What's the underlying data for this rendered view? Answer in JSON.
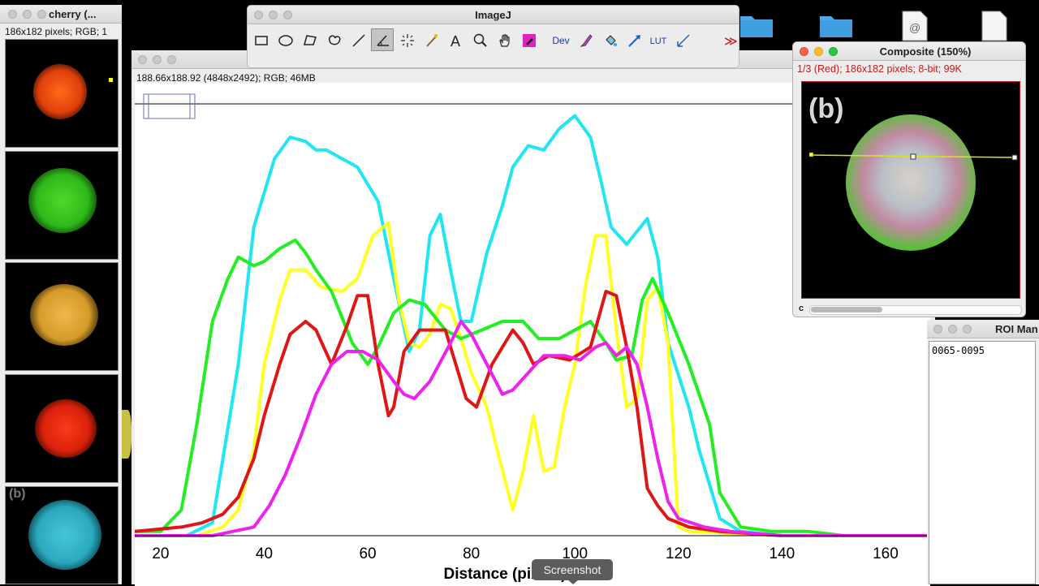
{
  "stack_window": {
    "title": "cherry (...",
    "info": "186x182 pixels; RGB; 1",
    "thumb_b_label": "(b)"
  },
  "plot_window": {
    "info": "188.66x188.92   (4848x2492); RGB; 46MB"
  },
  "imagej": {
    "title": "ImageJ",
    "tools": [
      {
        "name": "rectangle-tool"
      },
      {
        "name": "oval-tool"
      },
      {
        "name": "polygon-tool"
      },
      {
        "name": "freehand-tool"
      },
      {
        "name": "line-tool"
      },
      {
        "name": "angle-tool"
      },
      {
        "name": "point-tool"
      },
      {
        "name": "wand-tool"
      },
      {
        "name": "text-tool"
      },
      {
        "name": "magnifier-tool"
      },
      {
        "name": "hand-tool"
      },
      {
        "name": "color-picker-tool"
      },
      {
        "name": "dev-tool",
        "label": "Dev"
      },
      {
        "name": "brush-tool"
      },
      {
        "name": "flood-fill-tool"
      },
      {
        "name": "arrow-tool"
      },
      {
        "name": "lut-tool",
        "label": "LUT"
      },
      {
        "name": "stack-tool"
      },
      {
        "name": "more-tools"
      }
    ]
  },
  "composite": {
    "title": "Composite (150%)",
    "info": "1/3 (Red); 186x182 pixels; 8-bit; 99K",
    "panel_label": "(b)",
    "channel_label": "c"
  },
  "roi_manager": {
    "title": "ROI Man",
    "items": [
      "0065-0095"
    ]
  },
  "tooltip": "Screenshot",
  "chart_data": {
    "type": "line",
    "xlabel": "Distance (pixels)",
    "ylabel": "",
    "xlim": [
      15,
      168
    ],
    "ylim": [
      0,
      100
    ],
    "x_ticks": [
      20,
      40,
      60,
      80,
      100,
      120,
      140,
      160
    ],
    "grid": false,
    "colors": {
      "cyan": "#1fe6f2",
      "yellow": "#ffff22",
      "green": "#22ee22",
      "red": "#e01515",
      "magenta": "#ee22ee"
    },
    "series": [
      {
        "color": "cyan",
        "points": [
          [
            15,
            0
          ],
          [
            25,
            0
          ],
          [
            30,
            3
          ],
          [
            35,
            40
          ],
          [
            38,
            72
          ],
          [
            42,
            88
          ],
          [
            45,
            93
          ],
          [
            48,
            92
          ],
          [
            50,
            90
          ],
          [
            52,
            90
          ],
          [
            55,
            88
          ],
          [
            58,
            86
          ],
          [
            62,
            78
          ],
          [
            65,
            60
          ],
          [
            68,
            43
          ],
          [
            70,
            48
          ],
          [
            72,
            70
          ],
          [
            74,
            75
          ],
          [
            76,
            62
          ],
          [
            78,
            50
          ],
          [
            80,
            50
          ],
          [
            83,
            66
          ],
          [
            86,
            77
          ],
          [
            88,
            86
          ],
          [
            91,
            91
          ],
          [
            94,
            90
          ],
          [
            97,
            95
          ],
          [
            100,
            98
          ],
          [
            103,
            93
          ],
          [
            105,
            83
          ],
          [
            107,
            72
          ],
          [
            110,
            68
          ],
          [
            114,
            74
          ],
          [
            116,
            65
          ],
          [
            118,
            45
          ],
          [
            122,
            30
          ],
          [
            124,
            20
          ],
          [
            128,
            4
          ],
          [
            132,
            1
          ],
          [
            140,
            0
          ],
          [
            168,
            0
          ]
        ]
      },
      {
        "color": "yellow",
        "points": [
          [
            15,
            0
          ],
          [
            27,
            0
          ],
          [
            32,
            2
          ],
          [
            35,
            6
          ],
          [
            38,
            20
          ],
          [
            40,
            40
          ],
          [
            43,
            55
          ],
          [
            45,
            62
          ],
          [
            48,
            62
          ],
          [
            51,
            58
          ],
          [
            55,
            57
          ],
          [
            58,
            60
          ],
          [
            61,
            70
          ],
          [
            64,
            73
          ],
          [
            66,
            55
          ],
          [
            68,
            45
          ],
          [
            70,
            44
          ],
          [
            72,
            47
          ],
          [
            74,
            54
          ],
          [
            76,
            53
          ],
          [
            78,
            46
          ],
          [
            80,
            38
          ],
          [
            83,
            30
          ],
          [
            85,
            20
          ],
          [
            88,
            6
          ],
          [
            90,
            15
          ],
          [
            92,
            28
          ],
          [
            94,
            15
          ],
          [
            96,
            16
          ],
          [
            98,
            30
          ],
          [
            100,
            40
          ],
          [
            102,
            58
          ],
          [
            104,
            70
          ],
          [
            106,
            70
          ],
          [
            108,
            48
          ],
          [
            110,
            30
          ],
          [
            112,
            32
          ],
          [
            114,
            55
          ],
          [
            116,
            58
          ],
          [
            118,
            45
          ],
          [
            120,
            2
          ],
          [
            122,
            1
          ],
          [
            140,
            0
          ],
          [
            168,
            0
          ]
        ]
      },
      {
        "color": "green",
        "points": [
          [
            15,
            1
          ],
          [
            20,
            1
          ],
          [
            24,
            6
          ],
          [
            27,
            26
          ],
          [
            30,
            50
          ],
          [
            33,
            60
          ],
          [
            35,
            65
          ],
          [
            38,
            63
          ],
          [
            40,
            64
          ],
          [
            43,
            67
          ],
          [
            46,
            69
          ],
          [
            48,
            66
          ],
          [
            50,
            62
          ],
          [
            53,
            57
          ],
          [
            57,
            45
          ],
          [
            60,
            40
          ],
          [
            62,
            44
          ],
          [
            65,
            52
          ],
          [
            68,
            55
          ],
          [
            71,
            54
          ],
          [
            75,
            48
          ],
          [
            78,
            46
          ],
          [
            82,
            48
          ],
          [
            86,
            50
          ],
          [
            90,
            50
          ],
          [
            93,
            46
          ],
          [
            97,
            46
          ],
          [
            100,
            48
          ],
          [
            103,
            50
          ],
          [
            106,
            45
          ],
          [
            108,
            41
          ],
          [
            111,
            42
          ],
          [
            113,
            55
          ],
          [
            115,
            60
          ],
          [
            118,
            52
          ],
          [
            122,
            40
          ],
          [
            126,
            26
          ],
          [
            128,
            10
          ],
          [
            132,
            2
          ],
          [
            138,
            1
          ],
          [
            145,
            1
          ],
          [
            152,
            0
          ],
          [
            168,
            0
          ]
        ]
      },
      {
        "color": "red",
        "points": [
          [
            15,
            1
          ],
          [
            24,
            2
          ],
          [
            28,
            3
          ],
          [
            32,
            5
          ],
          [
            35,
            9
          ],
          [
            38,
            18
          ],
          [
            40,
            28
          ],
          [
            43,
            40
          ],
          [
            45,
            47
          ],
          [
            48,
            50
          ],
          [
            50,
            48
          ],
          [
            53,
            40
          ],
          [
            56,
            49
          ],
          [
            58,
            56
          ],
          [
            60,
            56
          ],
          [
            62,
            40
          ],
          [
            64,
            28
          ],
          [
            65,
            30
          ],
          [
            67,
            43
          ],
          [
            70,
            48
          ],
          [
            73,
            48
          ],
          [
            75,
            48
          ],
          [
            77,
            40
          ],
          [
            79,
            32
          ],
          [
            81,
            30
          ],
          [
            84,
            40
          ],
          [
            88,
            48
          ],
          [
            90,
            45
          ],
          [
            92,
            40
          ],
          [
            95,
            42
          ],
          [
            99,
            41
          ],
          [
            103,
            44
          ],
          [
            106,
            57
          ],
          [
            108,
            56
          ],
          [
            110,
            44
          ],
          [
            112,
            30
          ],
          [
            114,
            11
          ],
          [
            116,
            7
          ],
          [
            118,
            4
          ],
          [
            122,
            2
          ],
          [
            128,
            1
          ],
          [
            140,
            0
          ],
          [
            168,
            0
          ]
        ]
      },
      {
        "color": "magenta",
        "points": [
          [
            15,
            0
          ],
          [
            30,
            0
          ],
          [
            34,
            1
          ],
          [
            38,
            2
          ],
          [
            41,
            7
          ],
          [
            44,
            14
          ],
          [
            47,
            23
          ],
          [
            50,
            33
          ],
          [
            53,
            40
          ],
          [
            56,
            43
          ],
          [
            59,
            43
          ],
          [
            62,
            41
          ],
          [
            65,
            36
          ],
          [
            67,
            33
          ],
          [
            69,
            32
          ],
          [
            72,
            36
          ],
          [
            76,
            45
          ],
          [
            78,
            50
          ],
          [
            80,
            47
          ],
          [
            83,
            40
          ],
          [
            86,
            33
          ],
          [
            88,
            34
          ],
          [
            91,
            38
          ],
          [
            94,
            42
          ],
          [
            98,
            42
          ],
          [
            101,
            41
          ],
          [
            104,
            44
          ],
          [
            106,
            45
          ],
          [
            108,
            42
          ],
          [
            110,
            44
          ],
          [
            112,
            40
          ],
          [
            114,
            30
          ],
          [
            116,
            18
          ],
          [
            118,
            8
          ],
          [
            120,
            4
          ],
          [
            125,
            2
          ],
          [
            130,
            1
          ],
          [
            140,
            0
          ],
          [
            168,
            0
          ]
        ]
      }
    ]
  }
}
